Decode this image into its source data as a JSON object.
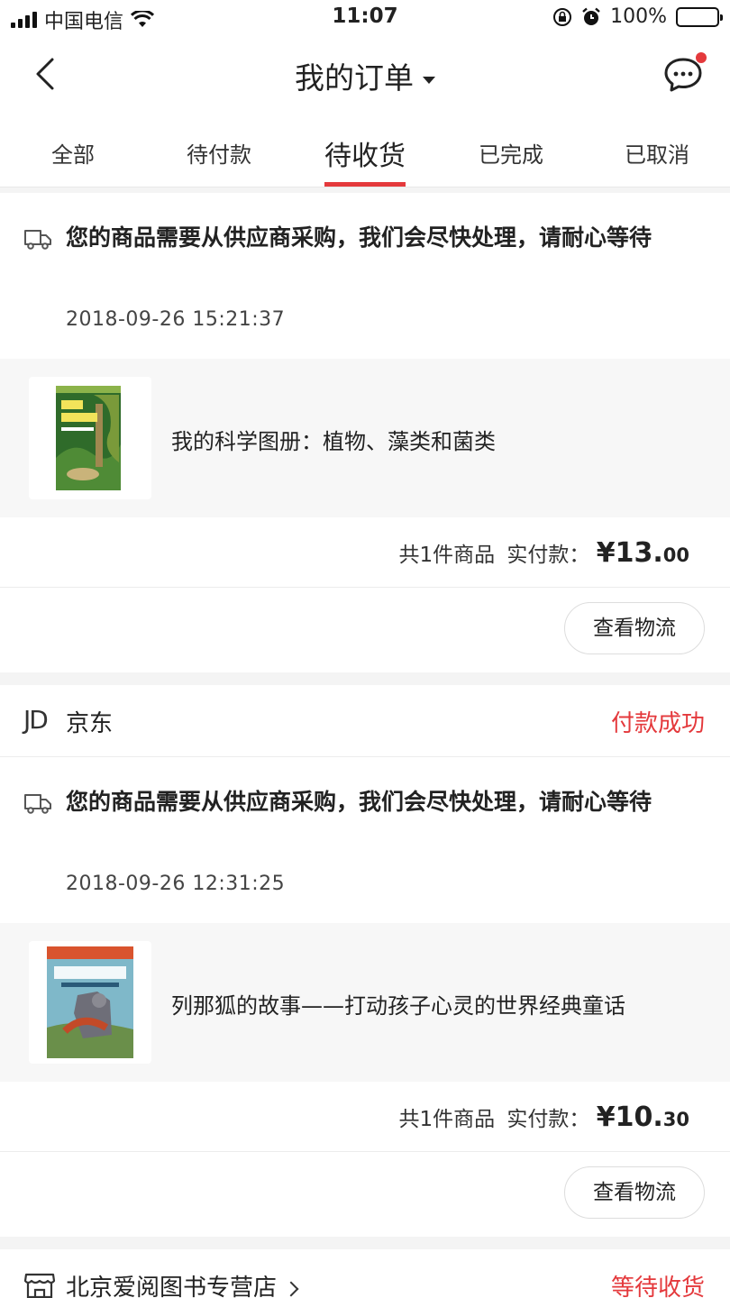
{
  "status_bar": {
    "carrier": "中国电信",
    "time": "11:07",
    "battery": "100%"
  },
  "nav": {
    "title": "我的订单"
  },
  "tabs": [
    {
      "label": "全部",
      "active": false
    },
    {
      "label": "待付款",
      "active": false
    },
    {
      "label": "待收货",
      "active": true
    },
    {
      "label": "已完成",
      "active": false
    },
    {
      "label": "已取消",
      "active": false
    }
  ],
  "orders": [
    {
      "notice": "您的商品需要从供应商采购，我们会尽快处理，请耐心等待",
      "time": "2018-09-26 15:21:37",
      "product_name": "我的科学图册：植物、藻类和菌类",
      "count_label": "共1件商品",
      "paid_label": "实付款：",
      "price_main": "¥13.",
      "price_cents": "00",
      "action": "查看物流"
    },
    {
      "shop": "京东",
      "shop_logo": "JD",
      "status": "付款成功",
      "notice": "您的商品需要从供应商采购，我们会尽快处理，请耐心等待",
      "time": "2018-09-26 12:31:25",
      "product_name": "列那狐的故事——打动孩子心灵的世界经典童话",
      "count_label": "共1件商品",
      "paid_label": "实付款：",
      "price_main": "¥10.",
      "price_cents": "30",
      "action": "查看物流"
    },
    {
      "shop": "北京爱阅图书专营店",
      "status": "等待收货"
    }
  ],
  "colors": {
    "accent": "#e4393c",
    "bg": "#f4f4f4",
    "product_bg": "#f7f7f7"
  }
}
